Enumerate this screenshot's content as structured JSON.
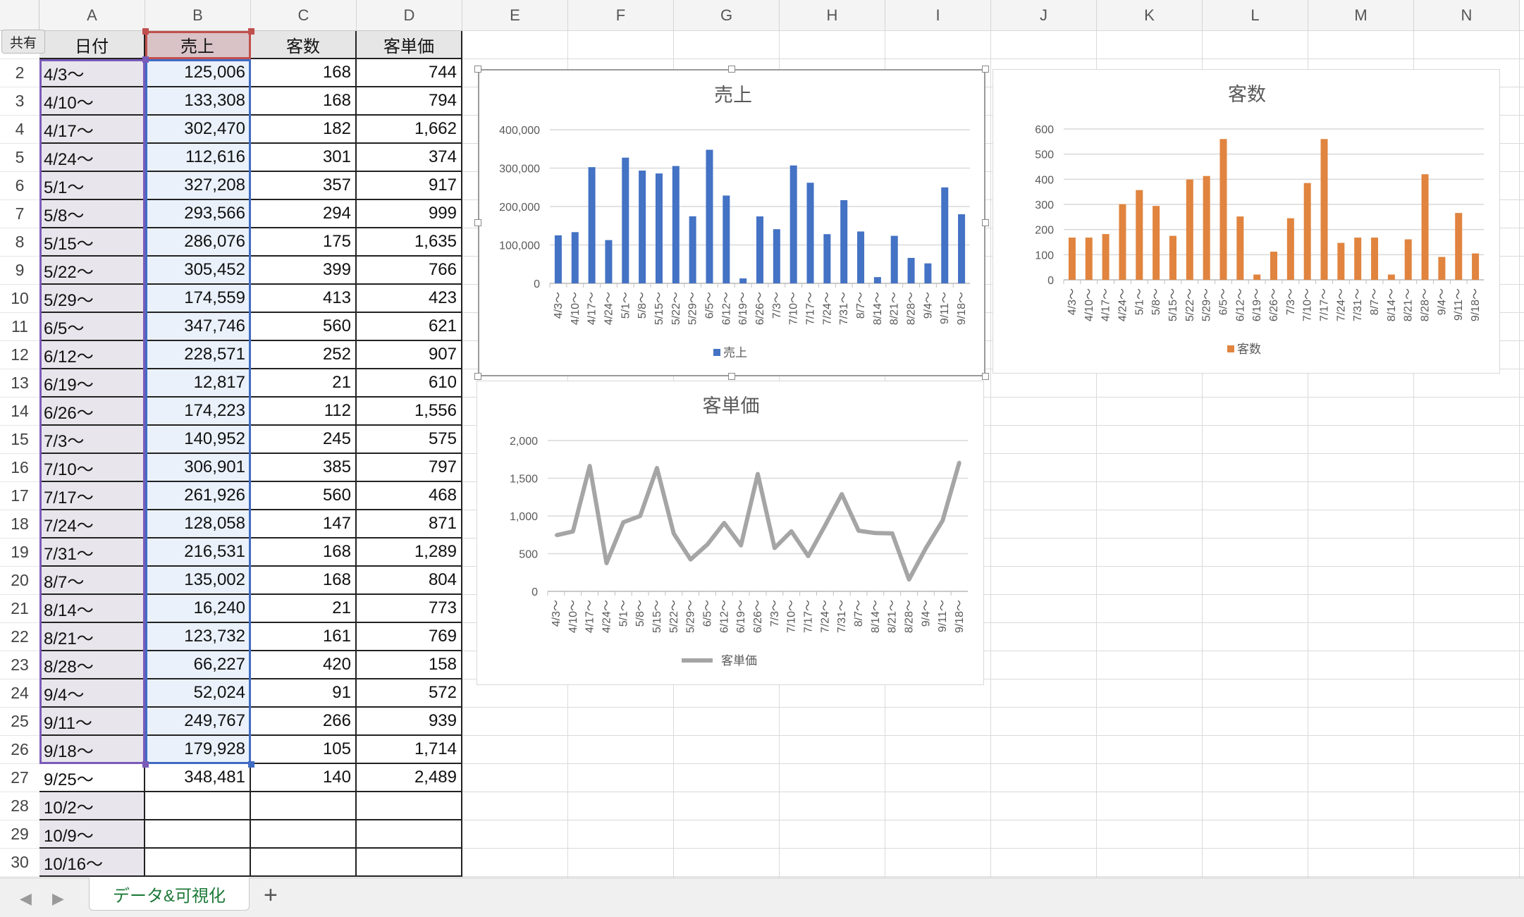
{
  "columns": [
    "A",
    "B",
    "C",
    "D",
    "E",
    "F",
    "G",
    "H",
    "I",
    "J",
    "K",
    "L",
    "M",
    "N"
  ],
  "row_numbers": [
    "2",
    "3",
    "4",
    "5",
    "6",
    "7",
    "8",
    "9",
    "10",
    "11",
    "12",
    "13",
    "14",
    "15",
    "16",
    "17",
    "18",
    "19",
    "20",
    "21",
    "22",
    "23",
    "24",
    "25",
    "26",
    "27",
    "28",
    "29",
    "30"
  ],
  "header_row": [
    "日付",
    "売上",
    "客数",
    "客単価"
  ],
  "rows": [
    [
      "4/3〜",
      "125,006",
      "168",
      "744"
    ],
    [
      "4/10〜",
      "133,308",
      "168",
      "794"
    ],
    [
      "4/17〜",
      "302,470",
      "182",
      "1,662"
    ],
    [
      "4/24〜",
      "112,616",
      "301",
      "374"
    ],
    [
      "5/1〜",
      "327,208",
      "357",
      "917"
    ],
    [
      "5/8〜",
      "293,566",
      "294",
      "999"
    ],
    [
      "5/15〜",
      "286,076",
      "175",
      "1,635"
    ],
    [
      "5/22〜",
      "305,452",
      "399",
      "766"
    ],
    [
      "5/29〜",
      "174,559",
      "413",
      "423"
    ],
    [
      "6/5〜",
      "347,746",
      "560",
      "621"
    ],
    [
      "6/12〜",
      "228,571",
      "252",
      "907"
    ],
    [
      "6/19〜",
      "12,817",
      "21",
      "610"
    ],
    [
      "6/26〜",
      "174,223",
      "112",
      "1,556"
    ],
    [
      "7/3〜",
      "140,952",
      "245",
      "575"
    ],
    [
      "7/10〜",
      "306,901",
      "385",
      "797"
    ],
    [
      "7/17〜",
      "261,926",
      "560",
      "468"
    ],
    [
      "7/24〜",
      "128,058",
      "147",
      "871"
    ],
    [
      "7/31〜",
      "216,531",
      "168",
      "1,289"
    ],
    [
      "8/7〜",
      "135,002",
      "168",
      "804"
    ],
    [
      "8/14〜",
      "16,240",
      "21",
      "773"
    ],
    [
      "8/21〜",
      "123,732",
      "161",
      "769"
    ],
    [
      "8/28〜",
      "66,227",
      "420",
      "158"
    ],
    [
      "9/4〜",
      "52,024",
      "91",
      "572"
    ],
    [
      "9/11〜",
      "249,767",
      "266",
      "939"
    ],
    [
      "9/18〜",
      "179,928",
      "105",
      "1,714"
    ],
    [
      "9/25〜",
      "348,481",
      "140",
      "2,489"
    ],
    [
      "10/2〜",
      "",
      "",
      ""
    ],
    [
      "10/9〜",
      "",
      "",
      ""
    ],
    [
      "10/16〜",
      "",
      "",
      ""
    ]
  ],
  "share_button": "共有",
  "sheet_tab": "データ&可視化",
  "add_sheet": "+",
  "nav_prev": "◀",
  "nav_next": "▶",
  "chart_data": [
    {
      "type": "bar",
      "title": "売上",
      "legend": "売上",
      "legend_position": "bottom",
      "color": "#4472c4",
      "ylim": [
        0,
        400000
      ],
      "yticks": [
        "0",
        "100,000",
        "200,000",
        "300,000",
        "400,000"
      ],
      "grid": true,
      "categories": [
        "4/3〜",
        "4/10〜",
        "4/17〜",
        "4/24〜",
        "5/1〜",
        "5/8〜",
        "5/15〜",
        "5/22〜",
        "5/29〜",
        "6/5〜",
        "6/12〜",
        "6/19〜",
        "6/26〜",
        "7/3〜",
        "7/10〜",
        "7/17〜",
        "7/24〜",
        "7/31〜",
        "8/7〜",
        "8/14〜",
        "8/21〜",
        "8/28〜",
        "9/4〜",
        "9/11〜",
        "9/18〜"
      ],
      "values": [
        125006,
        133308,
        302470,
        112616,
        327208,
        293566,
        286076,
        305452,
        174559,
        347746,
        228571,
        12817,
        174223,
        140952,
        306901,
        261926,
        128058,
        216531,
        135002,
        16240,
        123732,
        66227,
        52024,
        249767,
        179928
      ]
    },
    {
      "type": "bar",
      "title": "客数",
      "legend": "客数",
      "legend_position": "bottom",
      "color": "#e0843f",
      "ylim": [
        0,
        600
      ],
      "yticks": [
        "0",
        "100",
        "200",
        "300",
        "400",
        "500",
        "600"
      ],
      "grid": true,
      "categories": [
        "4/3〜",
        "4/10〜",
        "4/17〜",
        "4/24〜",
        "5/1〜",
        "5/8〜",
        "5/15〜",
        "5/22〜",
        "5/29〜",
        "6/5〜",
        "6/12〜",
        "6/19〜",
        "6/26〜",
        "7/3〜",
        "7/10〜",
        "7/17〜",
        "7/24〜",
        "7/31〜",
        "8/7〜",
        "8/14〜",
        "8/21〜",
        "8/28〜",
        "9/4〜",
        "9/11〜",
        "9/18〜"
      ],
      "values": [
        168,
        168,
        182,
        301,
        357,
        294,
        175,
        399,
        413,
        560,
        252,
        21,
        112,
        245,
        385,
        560,
        147,
        168,
        168,
        21,
        161,
        420,
        91,
        266,
        105
      ]
    },
    {
      "type": "line",
      "title": "客単価",
      "legend": "客単価",
      "legend_position": "bottom",
      "color": "#a5a5a5",
      "ylim": [
        0,
        2000
      ],
      "yticks": [
        "0",
        "500",
        "1,000",
        "1,500",
        "2,000"
      ],
      "grid": true,
      "categories": [
        "4/3〜",
        "4/10〜",
        "4/17〜",
        "4/24〜",
        "5/1〜",
        "5/8〜",
        "5/15〜",
        "5/22〜",
        "5/29〜",
        "6/5〜",
        "6/12〜",
        "6/19〜",
        "6/26〜",
        "7/3〜",
        "7/10〜",
        "7/17〜",
        "7/24〜",
        "7/31〜",
        "8/7〜",
        "8/14〜",
        "8/21〜",
        "8/28〜",
        "9/4〜",
        "9/11〜",
        "9/18〜"
      ],
      "values": [
        744,
        794,
        1662,
        374,
        917,
        999,
        1635,
        766,
        423,
        621,
        907,
        610,
        1556,
        575,
        797,
        468,
        871,
        1289,
        804,
        773,
        769,
        158,
        572,
        939,
        1714
      ]
    }
  ]
}
